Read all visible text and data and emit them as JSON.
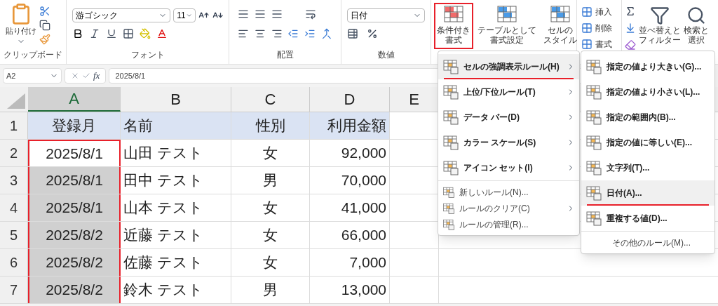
{
  "ribbon": {
    "clipboard": {
      "paste_label": "貼り付け",
      "group_label": "クリップボード"
    },
    "font": {
      "font_name": "游ゴシック",
      "font_size": "11",
      "group_label": "フォント"
    },
    "alignment": {
      "group_label": "配置"
    },
    "number": {
      "format": "日付",
      "group_label": "数値"
    },
    "styles": [
      {
        "lines": [
          "条件付き",
          "書式"
        ],
        "highlighted": true
      },
      {
        "lines": [
          "テーブルとして",
          "書式設定"
        ],
        "highlighted": false
      },
      {
        "lines": [
          "セルの",
          "スタイル"
        ],
        "highlighted": false
      }
    ],
    "cells": [
      "挿入",
      "削除",
      "書式"
    ],
    "editing": [
      {
        "lines": [
          "並べ替えと",
          "フィルター"
        ]
      },
      {
        "lines": [
          "検索と",
          "選択"
        ]
      }
    ]
  },
  "formula_bar": {
    "name_box": "A2",
    "function_label": "fx",
    "formula": "2025/8/1"
  },
  "sheet": {
    "columns": [
      {
        "label": "A",
        "selected": true
      },
      {
        "label": "B",
        "selected": false
      },
      {
        "label": "C",
        "selected": false
      },
      {
        "label": "D",
        "selected": false
      },
      {
        "label": "E",
        "selected": false
      }
    ],
    "rows": [
      {
        "header": "1",
        "cells": [
          "登録月",
          "名前",
          "性別",
          "利用金額"
        ]
      },
      {
        "header": "2",
        "cells": [
          "2025/8/1",
          "山田 テスト",
          "女",
          "92,000"
        ]
      },
      {
        "header": "3",
        "cells": [
          "2025/8/1",
          "田中 テスト",
          "男",
          "70,000"
        ]
      },
      {
        "header": "4",
        "cells": [
          "2025/8/1",
          "山本 テスト",
          "女",
          "41,000"
        ]
      },
      {
        "header": "5",
        "cells": [
          "2025/8/2",
          "近藤 テスト",
          "女",
          "66,000"
        ]
      },
      {
        "header": "6",
        "cells": [
          "2025/8/2",
          "佐藤 テスト",
          "女",
          "7,000"
        ]
      },
      {
        "header": "7",
        "cells": [
          "2025/8/2",
          "鈴木 テスト",
          "男",
          "13,000"
        ]
      }
    ]
  },
  "menu": [
    {
      "kind": "main",
      "label": "セルの強調表示ルール(H)",
      "selected": true,
      "underlined": true,
      "submenu": true
    },
    {
      "kind": "main",
      "label": "上位/下位ルール(T)",
      "selected": false,
      "underlined": false,
      "submenu": true
    },
    {
      "kind": "main",
      "label": "データ バー(D)",
      "selected": false,
      "underlined": false,
      "submenu": true
    },
    {
      "kind": "main",
      "label": "カラー スケール(S)",
      "selected": false,
      "underlined": false,
      "submenu": true
    },
    {
      "kind": "main",
      "label": "アイコン セット(I)",
      "selected": false,
      "underlined": false,
      "submenu": true
    },
    {
      "kind": "small",
      "label": "新しいルール(N)...",
      "selected": false,
      "underlined": false,
      "submenu": false
    },
    {
      "kind": "small",
      "label": "ルールのクリア(C)",
      "selected": false,
      "underlined": false,
      "submenu": true
    },
    {
      "kind": "small",
      "label": "ルールの管理(R)...",
      "selected": false,
      "underlined": false,
      "submenu": false
    }
  ],
  "submenu": [
    {
      "kind": "main",
      "label": "指定の値より大きい(G)...",
      "selected": false,
      "underlined": false
    },
    {
      "kind": "main",
      "label": "指定の値より小さい(L)...",
      "selected": false,
      "underlined": false
    },
    {
      "kind": "main",
      "label": "指定の範囲内(B)...",
      "selected": false,
      "underlined": false
    },
    {
      "kind": "main",
      "label": "指定の値に等しい(E)...",
      "selected": false,
      "underlined": false
    },
    {
      "kind": "main",
      "label": "文字列(T)...",
      "selected": false,
      "underlined": false
    },
    {
      "kind": "main",
      "label": "日付(A)...",
      "selected": true,
      "underlined": true
    },
    {
      "kind": "main",
      "label": "重複する値(D)...",
      "selected": false,
      "underlined": false
    },
    {
      "kind": "small",
      "label": "その他のルール(M)...",
      "selected": false,
      "underlined": false
    }
  ]
}
